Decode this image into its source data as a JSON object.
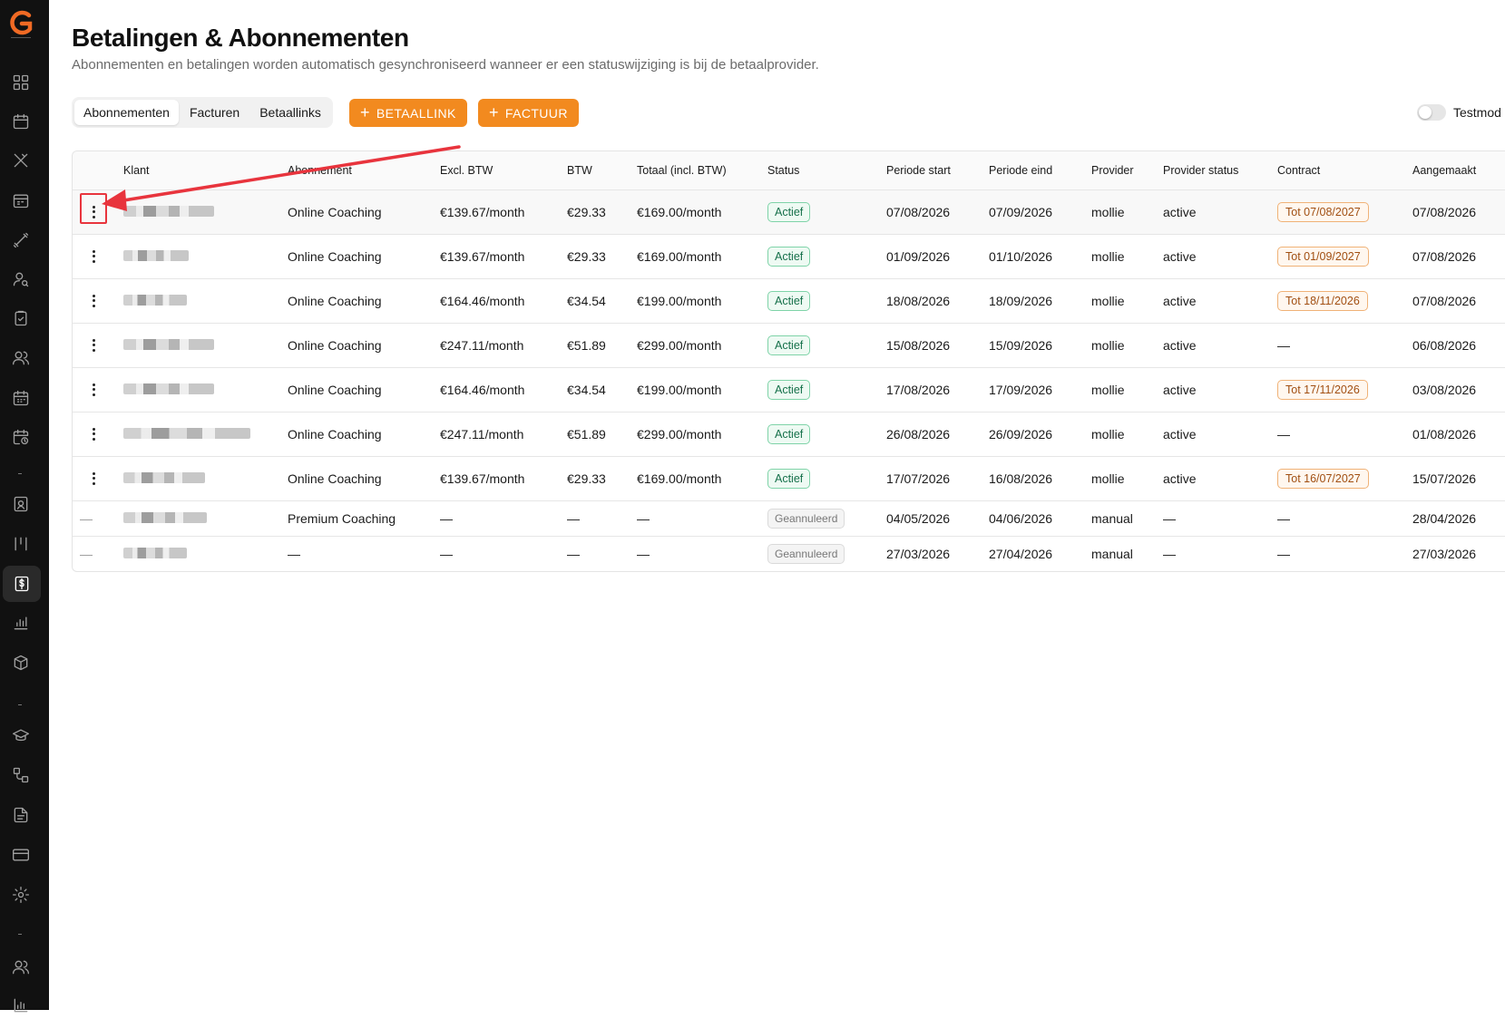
{
  "page": {
    "title": "Betalingen & Abonnementen",
    "subtitle": "Abonnementen en betalingen worden automatisch gesynchroniseerd wanneer er een statuswijziging is bij de betaalprovider."
  },
  "tabs": [
    {
      "label": "Abonnementen",
      "active": true
    },
    {
      "label": "Facturen",
      "active": false
    },
    {
      "label": "Betaallinks",
      "active": false
    }
  ],
  "buttons": {
    "betaallink_label": "BETAALLINK",
    "factuur_label": "FACTUUR",
    "plus": "+"
  },
  "testmode": {
    "label": "Testmod",
    "enabled": false
  },
  "table": {
    "headers": [
      "Klant",
      "Abonnement",
      "Excl. BTW",
      "BTW",
      "Totaal (incl. BTW)",
      "Status",
      "Periode start",
      "Periode eind",
      "Provider",
      "Provider status",
      "Contract",
      "Aangemaakt"
    ],
    "rows": [
      {
        "abonnement": "Online Coaching",
        "excl": "€139.67/month",
        "btw": "€29.33",
        "totaal": "€169.00/month",
        "status": "Actief",
        "start": "07/08/2026",
        "eind": "07/09/2026",
        "provider": "mollie",
        "provider_status": "active",
        "contract": "Tot 07/08/2027",
        "aangemaakt": "07/08/2026"
      },
      {
        "abonnement": "Online Coaching",
        "excl": "€139.67/month",
        "btw": "€29.33",
        "totaal": "€169.00/month",
        "status": "Actief",
        "start": "01/09/2026",
        "eind": "01/10/2026",
        "provider": "mollie",
        "provider_status": "active",
        "contract": "Tot 01/09/2027",
        "aangemaakt": "07/08/2026"
      },
      {
        "abonnement": "Online Coaching",
        "excl": "€164.46/month",
        "btw": "€34.54",
        "totaal": "€199.00/month",
        "status": "Actief",
        "start": "18/08/2026",
        "eind": "18/09/2026",
        "provider": "mollie",
        "provider_status": "active",
        "contract": "Tot 18/11/2026",
        "aangemaakt": "07/08/2026"
      },
      {
        "abonnement": "Online Coaching",
        "excl": "€247.11/month",
        "btw": "€51.89",
        "totaal": "€299.00/month",
        "status": "Actief",
        "start": "15/08/2026",
        "eind": "15/09/2026",
        "provider": "mollie",
        "provider_status": "active",
        "contract": "—",
        "aangemaakt": "06/08/2026"
      },
      {
        "abonnement": "Online Coaching",
        "excl": "€164.46/month",
        "btw": "€34.54",
        "totaal": "€199.00/month",
        "status": "Actief",
        "start": "17/08/2026",
        "eind": "17/09/2026",
        "provider": "mollie",
        "provider_status": "active",
        "contract": "Tot 17/11/2026",
        "aangemaakt": "03/08/2026"
      },
      {
        "abonnement": "Online Coaching",
        "excl": "€247.11/month",
        "btw": "€51.89",
        "totaal": "€299.00/month",
        "status": "Actief",
        "start": "26/08/2026",
        "eind": "26/09/2026",
        "provider": "mollie",
        "provider_status": "active",
        "contract": "—",
        "aangemaakt": "01/08/2026"
      },
      {
        "abonnement": "Online Coaching",
        "excl": "€139.67/month",
        "btw": "€29.33",
        "totaal": "€169.00/month",
        "status": "Actief",
        "start": "17/07/2026",
        "eind": "16/08/2026",
        "provider": "mollie",
        "provider_status": "active",
        "contract": "Tot 16/07/2027",
        "aangemaakt": "15/07/2026"
      },
      {
        "abonnement": "Premium Coaching",
        "excl": "—",
        "btw": "—",
        "totaal": "—",
        "status": "Geannuleerd",
        "start": "04/05/2026",
        "eind": "04/06/2026",
        "provider": "manual",
        "provider_status": "—",
        "contract": "—",
        "aangemaakt": "28/04/2026"
      },
      {
        "abonnement": "—",
        "excl": "—",
        "btw": "—",
        "totaal": "—",
        "status": "Geannuleerd",
        "start": "27/03/2026",
        "eind": "27/04/2026",
        "provider": "manual",
        "provider_status": "—",
        "contract": "—",
        "aangemaakt": "27/03/2026"
      }
    ]
  },
  "sidebar": {
    "icons": [
      "dashboard-icon",
      "calendar-icon",
      "utensils-icon",
      "calendar-grid-icon",
      "dumbbell-icon",
      "user-search-icon",
      "clipboard-check-icon",
      "users-icon",
      "calendar-days-icon",
      "calendar-clock-icon",
      "id-badge-icon",
      "columns-icon",
      "dollar-icon",
      "bar-chart-icon",
      "package-icon",
      "graduation-cap-icon",
      "workflow-icon",
      "document-icon",
      "credit-card-icon",
      "settings-icon",
      "user-group-icon",
      "chart-icon"
    ],
    "active": "dollar-icon"
  },
  "colors": {
    "accent": "#f28a1f",
    "sidebar_bg": "#111111",
    "status_active": "#15704a",
    "annotation": "#e8343d"
  }
}
